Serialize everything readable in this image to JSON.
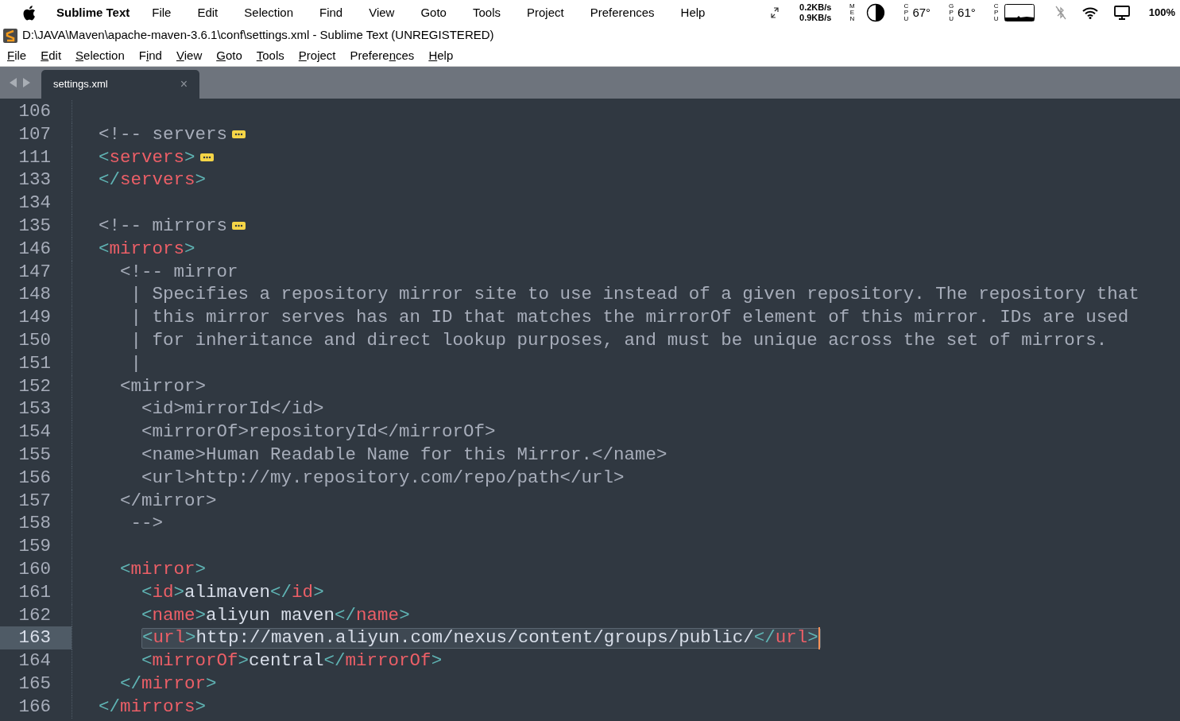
{
  "mac_menu_bar": {
    "app_name": "Sublime Text",
    "items": [
      "File",
      "Edit",
      "Selection",
      "Find",
      "View",
      "Goto",
      "Tools",
      "Project",
      "Preferences",
      "Help"
    ],
    "status": {
      "net_up": "0.2KB/s",
      "net_down": "0.9KB/s",
      "mem_label": "MEN",
      "cpu_label": "CPU",
      "cpu_temp": "67°",
      "gpu_label": "GPU",
      "gpu_temp": "61°",
      "cpu_graph_label": "CPU",
      "battery": "100%"
    }
  },
  "window": {
    "title": "D:\\JAVA\\Maven\\apache-maven-3.6.1\\conf\\settings.xml - Sublime Text (UNREGISTERED)"
  },
  "menu": [
    {
      "key": "F",
      "post": "ile"
    },
    {
      "key": "E",
      "post": "dit"
    },
    {
      "key": "S",
      "post": "election"
    },
    {
      "pre": "F",
      "key": "i",
      "post": "nd"
    },
    {
      "key": "V",
      "post": "iew"
    },
    {
      "key": "G",
      "post": "oto"
    },
    {
      "key": "T",
      "post": "ools"
    },
    {
      "key": "P",
      "post": "roject"
    },
    {
      "pre": "Prefere",
      "key": "n",
      "post": "ces"
    },
    {
      "key": "H",
      "post": "elp"
    }
  ],
  "tabs": [
    {
      "label": "settings.xml",
      "selected": true,
      "close": "×"
    }
  ],
  "lines": [
    {
      "number": "106",
      "selected": false
    },
    {
      "number": "107",
      "selected": false,
      "folded": true,
      "tokens": [
        {
          "kind": "comment",
          "text": "  <!-- servers"
        }
      ]
    },
    {
      "number": "111",
      "selected": false,
      "folded": true,
      "tokens": [
        {
          "kind": "bracket",
          "text": "  <"
        },
        {
          "kind": "tag",
          "text": "servers"
        },
        {
          "kind": "bracket",
          "text": ">"
        }
      ]
    },
    {
      "number": "133",
      "selected": false,
      "tokens": [
        {
          "kind": "bracket",
          "text": "  </"
        },
        {
          "kind": "tag",
          "text": "servers"
        },
        {
          "kind": "bracket",
          "text": ">"
        }
      ]
    },
    {
      "number": "134",
      "selected": false
    },
    {
      "number": "135",
      "selected": false,
      "folded": true,
      "tokens": [
        {
          "kind": "comment",
          "text": "  <!-- mirrors"
        }
      ]
    },
    {
      "number": "146",
      "selected": false,
      "tokens": [
        {
          "kind": "bracket",
          "text": "  <"
        },
        {
          "kind": "tag",
          "text": "mirrors"
        },
        {
          "kind": "bracket",
          "text": ">"
        }
      ]
    },
    {
      "number": "147",
      "selected": false,
      "tokens": [
        {
          "kind": "comment",
          "text": "    <!-- mirror"
        }
      ]
    },
    {
      "number": "148",
      "selected": false,
      "tokens": [
        {
          "kind": "comment",
          "text": "     | Specifies a repository mirror site to use instead of a given repository. The repository that"
        }
      ]
    },
    {
      "number": "149",
      "selected": false,
      "tokens": [
        {
          "kind": "comment",
          "text": "     | this mirror serves has an ID that matches the mirrorOf element of this mirror. IDs are used"
        }
      ]
    },
    {
      "number": "150",
      "selected": false,
      "tokens": [
        {
          "kind": "comment",
          "text": "     | for inheritance and direct lookup purposes, and must be unique across the set of mirrors."
        }
      ]
    },
    {
      "number": "151",
      "selected": false,
      "tokens": [
        {
          "kind": "comment",
          "text": "     |"
        }
      ]
    },
    {
      "number": "152",
      "selected": false,
      "tokens": [
        {
          "kind": "comment",
          "text": "    <mirror>"
        }
      ]
    },
    {
      "number": "153",
      "selected": false,
      "tokens": [
        {
          "kind": "comment",
          "text": "      <id>mirrorId</id>"
        }
      ]
    },
    {
      "number": "154",
      "selected": false,
      "tokens": [
        {
          "kind": "comment",
          "text": "      <mirrorOf>repositoryId</mirrorOf>"
        }
      ]
    },
    {
      "number": "155",
      "selected": false,
      "tokens": [
        {
          "kind": "comment",
          "text": "      <name>Human Readable Name for this Mirror.</name>"
        }
      ]
    },
    {
      "number": "156",
      "selected": false,
      "tokens": [
        {
          "kind": "comment",
          "text": "      <url>http://my.repository.com/repo/path</url>"
        }
      ]
    },
    {
      "number": "157",
      "selected": false,
      "tokens": [
        {
          "kind": "comment",
          "text": "    </mirror>"
        }
      ]
    },
    {
      "number": "158",
      "selected": false,
      "tokens": [
        {
          "kind": "comment",
          "text": "     -->"
        }
      ]
    },
    {
      "number": "159",
      "selected": false
    },
    {
      "number": "160",
      "selected": false,
      "tokens": [
        {
          "kind": "bracket",
          "text": "    <"
        },
        {
          "kind": "tag",
          "text": "mirror"
        },
        {
          "kind": "bracket",
          "text": ">"
        }
      ]
    },
    {
      "number": "161",
      "selected": false,
      "tokens": [
        {
          "kind": "bracket",
          "text": "      <"
        },
        {
          "kind": "tag",
          "text": "id"
        },
        {
          "kind": "bracket",
          "text": ">"
        },
        {
          "kind": "text",
          "text": "alimaven"
        },
        {
          "kind": "bracket",
          "text": "</"
        },
        {
          "kind": "tag",
          "text": "id"
        },
        {
          "kind": "bracket",
          "text": ">"
        }
      ]
    },
    {
      "number": "162",
      "selected": false,
      "tokens": [
        {
          "kind": "bracket",
          "text": "      <"
        },
        {
          "kind": "tag",
          "text": "name"
        },
        {
          "kind": "bracket",
          "text": ">"
        },
        {
          "kind": "text",
          "text": "aliyun maven"
        },
        {
          "kind": "bracket",
          "text": "</"
        },
        {
          "kind": "tag",
          "text": "name"
        },
        {
          "kind": "bracket",
          "text": ">"
        }
      ]
    },
    {
      "number": "163",
      "selected": true,
      "tokens": [
        {
          "kind": "bracket",
          "text": "      <"
        },
        {
          "kind": "tag",
          "text": "url"
        },
        {
          "kind": "bracket",
          "text": ">"
        },
        {
          "kind": "text",
          "text": "http://maven.aliyun.com/nexus/content/groups/public/"
        },
        {
          "kind": "bracket",
          "text": "</"
        },
        {
          "kind": "tag",
          "text": "url"
        },
        {
          "kind": "bracket",
          "text": ">"
        }
      ]
    },
    {
      "number": "164",
      "selected": false,
      "tokens": [
        {
          "kind": "bracket",
          "text": "      <"
        },
        {
          "kind": "tag",
          "text": "mirrorOf"
        },
        {
          "kind": "bracket",
          "text": ">"
        },
        {
          "kind": "text",
          "text": "central"
        },
        {
          "kind": "bracket",
          "text": "</"
        },
        {
          "kind": "tag",
          "text": "mirrorOf"
        },
        {
          "kind": "bracket",
          "text": ">"
        }
      ]
    },
    {
      "number": "165",
      "selected": false,
      "tokens": [
        {
          "kind": "bracket",
          "text": "    </"
        },
        {
          "kind": "tag",
          "text": "mirror"
        },
        {
          "kind": "bracket",
          "text": ">"
        }
      ]
    },
    {
      "number": "166",
      "selected": false,
      "tokens": [
        {
          "kind": "bracket",
          "text": "  </"
        },
        {
          "kind": "tag",
          "text": "mirrors"
        },
        {
          "kind": "bracket",
          "text": ">"
        }
      ]
    }
  ]
}
